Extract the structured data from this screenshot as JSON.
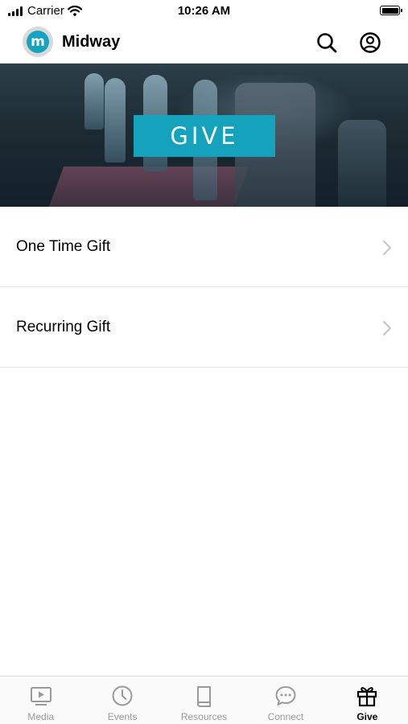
{
  "status_bar": {
    "carrier": "Carrier",
    "time": "10:26 AM",
    "battery_level": 1.0
  },
  "header": {
    "logo_letter": "m",
    "title": "Midway",
    "search_icon": "search-icon",
    "account_icon": "account-icon"
  },
  "banner": {
    "label": "GIVE"
  },
  "list": {
    "items": [
      {
        "label": "One Time Gift",
        "icon": "chevron-right-icon"
      },
      {
        "label": "Recurring Gift",
        "icon": "chevron-right-icon"
      }
    ]
  },
  "tab_bar": {
    "items": [
      {
        "label": "Media",
        "icon": "play-video-icon",
        "active": false
      },
      {
        "label": "Events",
        "icon": "clock-icon",
        "active": false
      },
      {
        "label": "Resources",
        "icon": "book-icon",
        "active": false
      },
      {
        "label": "Connect",
        "icon": "chat-bubble-icon",
        "active": false
      },
      {
        "label": "Give",
        "icon": "gift-icon",
        "active": true
      }
    ]
  },
  "colors": {
    "accent": "#15a2bc",
    "tab_inactive": "#9a9a9a",
    "tab_active": "#000000"
  }
}
